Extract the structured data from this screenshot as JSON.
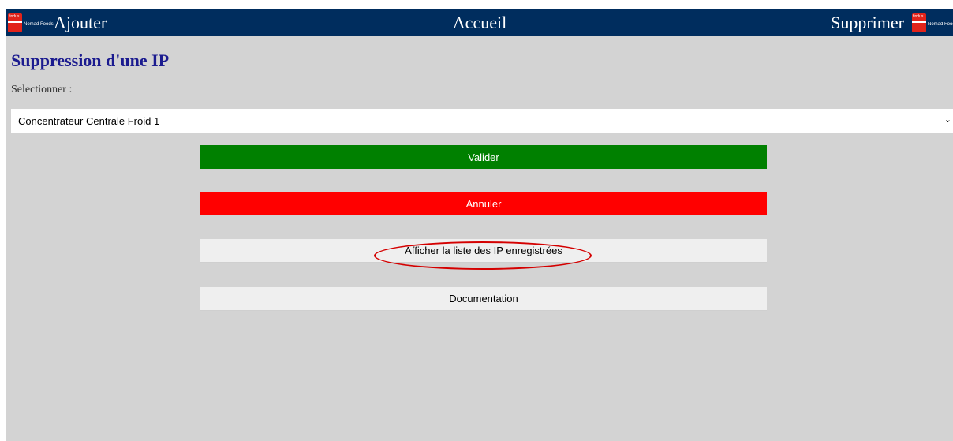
{
  "navbar": {
    "add_label": "Ajouter",
    "home_label": "Accueil",
    "delete_label": "Supprimer",
    "logo_brand": "Nomad Foods",
    "logo_word": "findus"
  },
  "page": {
    "title": "Suppression d'une IP",
    "select_label": "Selectionner :",
    "select_value": "Concentrateur Centrale Froid 1"
  },
  "buttons": {
    "validate": "Valider",
    "cancel": "Annuler",
    "show_list": "Afficher la liste des IP enregistrées",
    "documentation": "Documentation"
  },
  "colors": {
    "navbar_bg": "#002d5e",
    "validate_bg": "#008000",
    "cancel_bg": "#ff0000",
    "title_color": "#1b1b8f",
    "highlight": "#d40000"
  }
}
